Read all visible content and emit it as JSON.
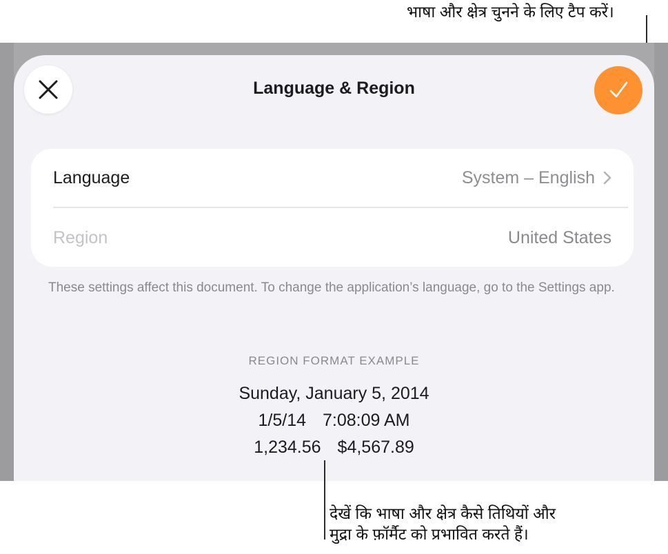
{
  "callouts": {
    "top": "भाषा और क्षेत्र चुनने के लिए टैप करें।",
    "bottom_line1": "देखें कि भाषा और क्षेत्र कैसे तिथियों और",
    "bottom_line2": "मुद्रा के फ़ॉर्मैट को प्रभावित करते हैं।"
  },
  "sheet": {
    "title": "Language & Region",
    "close_icon": "close-icon",
    "done_icon": "checkmark-icon",
    "accent_color": "#ff9230"
  },
  "settings": {
    "language_label": "Language",
    "language_value": "System – English",
    "region_label": "Region",
    "region_value": "United States",
    "note": "These settings affect this document. To change the application’s language, go to the Settings app."
  },
  "example": {
    "heading": "REGION FORMAT EXAMPLE",
    "date": "Sunday, January 5, 2014",
    "short_date": "1/5/14",
    "time": "7:08:09 AM",
    "number": "1,234.56",
    "currency": "$4,567.89"
  }
}
